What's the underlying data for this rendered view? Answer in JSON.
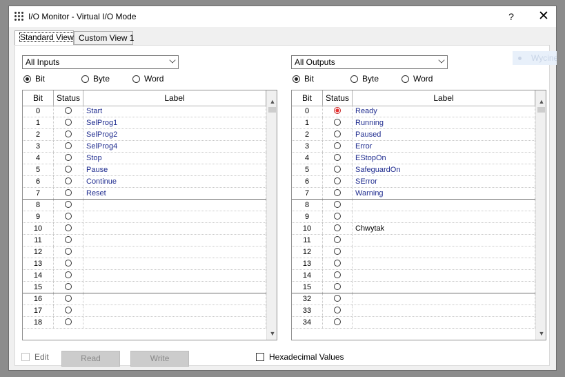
{
  "window": {
    "title": "I/O Monitor - Virtual I/O Mode",
    "help_label": "?",
    "close_label": "✕"
  },
  "tabs": [
    {
      "label": "Standard View",
      "active": true
    },
    {
      "label": "Custom View 1",
      "active": false
    }
  ],
  "inputs": {
    "filter": "All Inputs",
    "radios": [
      {
        "label": "Bit",
        "checked": true
      },
      {
        "label": "Byte",
        "checked": false
      },
      {
        "label": "Word",
        "checked": false
      }
    ],
    "columns": [
      "Bit",
      "Status",
      "Label"
    ],
    "rows": [
      {
        "bit": "0",
        "on": false,
        "label": "Start"
      },
      {
        "bit": "1",
        "on": false,
        "label": "SelProg1"
      },
      {
        "bit": "2",
        "on": false,
        "label": "SelProg2"
      },
      {
        "bit": "3",
        "on": false,
        "label": "SelProg4"
      },
      {
        "bit": "4",
        "on": false,
        "label": "Stop"
      },
      {
        "bit": "5",
        "on": false,
        "label": "Pause"
      },
      {
        "bit": "6",
        "on": false,
        "label": "Continue"
      },
      {
        "bit": "7",
        "on": false,
        "label": "Reset"
      },
      {
        "bit": "8",
        "on": false,
        "label": ""
      },
      {
        "bit": "9",
        "on": false,
        "label": ""
      },
      {
        "bit": "10",
        "on": false,
        "label": ""
      },
      {
        "bit": "11",
        "on": false,
        "label": ""
      },
      {
        "bit": "12",
        "on": false,
        "label": ""
      },
      {
        "bit": "13",
        "on": false,
        "label": ""
      },
      {
        "bit": "14",
        "on": false,
        "label": ""
      },
      {
        "bit": "15",
        "on": false,
        "label": ""
      },
      {
        "bit": "16",
        "on": false,
        "label": ""
      },
      {
        "bit": "17",
        "on": false,
        "label": ""
      },
      {
        "bit": "18",
        "on": false,
        "label": ""
      }
    ]
  },
  "outputs": {
    "filter": "All Outputs",
    "radios": [
      {
        "label": "Bit",
        "checked": true
      },
      {
        "label": "Byte",
        "checked": false
      },
      {
        "label": "Word",
        "checked": false
      }
    ],
    "columns": [
      "Bit",
      "Status",
      "Label"
    ],
    "rows": [
      {
        "bit": "0",
        "on": true,
        "label": "Ready"
      },
      {
        "bit": "1",
        "on": false,
        "label": "Running"
      },
      {
        "bit": "2",
        "on": false,
        "label": "Paused"
      },
      {
        "bit": "3",
        "on": false,
        "label": "Error"
      },
      {
        "bit": "4",
        "on": false,
        "label": "EStopOn"
      },
      {
        "bit": "5",
        "on": false,
        "label": "SafeguardOn"
      },
      {
        "bit": "6",
        "on": false,
        "label": "SError"
      },
      {
        "bit": "7",
        "on": false,
        "label": "Warning"
      },
      {
        "bit": "8",
        "on": false,
        "label": ""
      },
      {
        "bit": "9",
        "on": false,
        "label": ""
      },
      {
        "bit": "10",
        "on": false,
        "label": "Chwytak"
      },
      {
        "bit": "11",
        "on": false,
        "label": ""
      },
      {
        "bit": "12",
        "on": false,
        "label": ""
      },
      {
        "bit": "13",
        "on": false,
        "label": ""
      },
      {
        "bit": "14",
        "on": false,
        "label": ""
      },
      {
        "bit": "15",
        "on": false,
        "label": ""
      },
      {
        "bit": "32",
        "on": false,
        "label": ""
      },
      {
        "bit": "33",
        "on": false,
        "label": ""
      },
      {
        "bit": "34",
        "on": false,
        "label": ""
      }
    ]
  },
  "bottom": {
    "edit_label": "Edit",
    "read_label": "Read",
    "write_label": "Write",
    "hex_label": "Hexadecimal Values"
  },
  "background_ghost": {
    "label": "Wycinek"
  },
  "colors": {
    "label_text": "#1f2c8f",
    "status_on": "#e83030"
  }
}
